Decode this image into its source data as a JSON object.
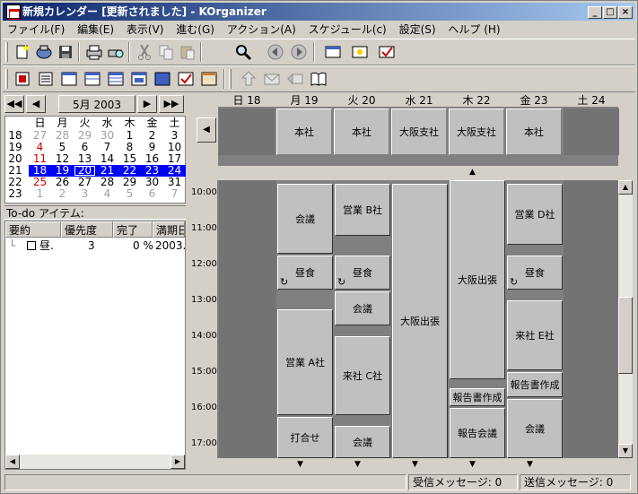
{
  "window": {
    "title": "新規カレンダー [更新されました] - KOrganizer"
  },
  "menu": [
    "ファイル(F)",
    "編集(E)",
    "表示(V)",
    "進む(G)",
    "アクション(A)",
    "スケジュール(c)",
    "設定(S)",
    "ヘルプ (H)"
  ],
  "nav": {
    "month": "5月 2003"
  },
  "minical": {
    "headers": [
      "日",
      "月",
      "火",
      "水",
      "木",
      "金",
      "土"
    ],
    "weeks": [
      {
        "wk": "18",
        "days": [
          "27",
          "28",
          "29",
          "30",
          "1",
          "2",
          "3"
        ]
      },
      {
        "wk": "19",
        "days": [
          "4",
          "5",
          "6",
          "7",
          "8",
          "9",
          "10"
        ]
      },
      {
        "wk": "20",
        "days": [
          "11",
          "12",
          "13",
          "14",
          "15",
          "16",
          "17"
        ]
      },
      {
        "wk": "21",
        "days": [
          "18",
          "19",
          "20",
          "21",
          "22",
          "23",
          "24"
        ]
      },
      {
        "wk": "22",
        "days": [
          "25",
          "26",
          "27",
          "28",
          "29",
          "30",
          "31"
        ]
      },
      {
        "wk": "23",
        "days": [
          "1",
          "2",
          "3",
          "4",
          "5",
          "6",
          "7"
        ]
      }
    ]
  },
  "todo": {
    "title": "To-do アイテム:",
    "columns": [
      "要約",
      "優先度",
      "完了",
      "満期日"
    ],
    "rows": [
      {
        "summary": "昼.",
        "priority": "3",
        "done": "0 %",
        "due": "2003."
      }
    ]
  },
  "days": [
    "日 18",
    "月 19",
    "火 20",
    "水 21",
    "木 22",
    "金 23",
    "土 24"
  ],
  "allday": [
    "",
    "本社",
    "本社",
    "大阪支社",
    "大阪支社",
    "本社",
    ""
  ],
  "times": [
    "10:00",
    "11:00",
    "12:00",
    "13:00",
    "14:00",
    "15:00",
    "16:00",
    "17:00"
  ],
  "events": {
    "mon": [
      "会議",
      "昼食",
      "営業 A社",
      "打合せ"
    ],
    "tue": [
      "営業 B社",
      "昼食",
      "会議",
      "来社 C社",
      "会議"
    ],
    "wed": [
      "大阪出張"
    ],
    "thu": [
      "大阪出張",
      "報告書作成",
      "報告会議"
    ],
    "fri": [
      "営業 D社",
      "昼食",
      "来社 E社",
      "報告書作成",
      "会議"
    ]
  },
  "status": {
    "incoming": "受信メッセージ: 0",
    "outgoing": "送信メッセージ: 0"
  },
  "colors": {
    "title_start": "#0a246a",
    "title_end": "#a6caf0",
    "selection": "#0000ff"
  }
}
